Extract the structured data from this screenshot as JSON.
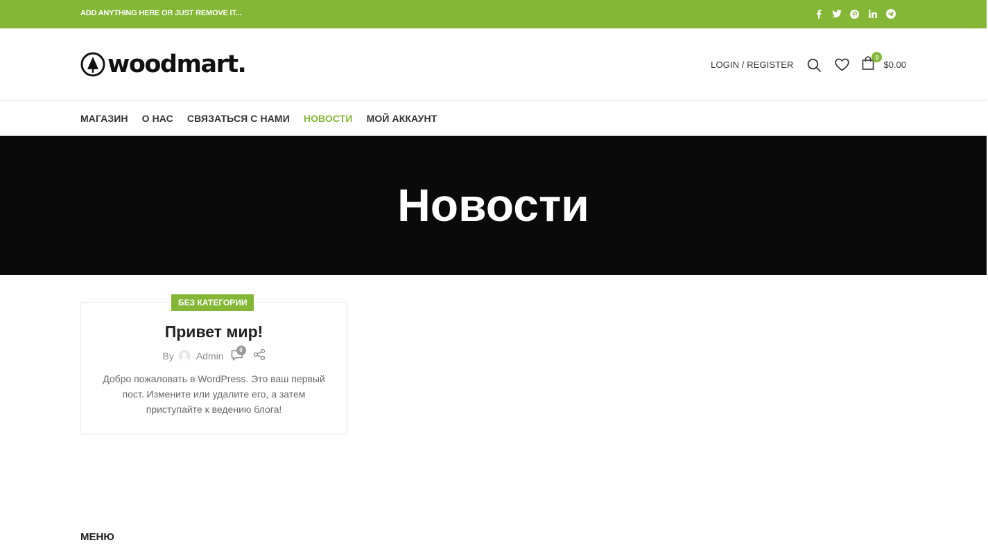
{
  "topbar": {
    "text": "ADD ANYTHING HERE OR JUST REMOVE IT...",
    "social": [
      "facebook-icon",
      "twitter-icon",
      "pinterest-icon",
      "linkedin-icon",
      "telegram-icon"
    ]
  },
  "header": {
    "logo_text": "woodmart.",
    "login_label": "LOGIN / REGISTER",
    "cart_count": "0",
    "cart_amount": "$0.00"
  },
  "nav": {
    "items": [
      {
        "label": "МАГАЗИН"
      },
      {
        "label": "О НАС"
      },
      {
        "label": "СВЯЗАТЬСЯ С НАМИ"
      },
      {
        "label": "НОВОСТИ",
        "active": true
      },
      {
        "label": "МОЙ АККАУНТ"
      }
    ]
  },
  "hero": {
    "title": "Новости"
  },
  "post": {
    "category": "БЕЗ КАТЕГОРИИ",
    "title": "Привет мир!",
    "by": "By",
    "author": "Admin",
    "comment_count": "0",
    "excerpt": "Добро пожаловать в WordPress. Это ваш первый пост. Измените или удалите его, а затем приступайте к ведению блога!"
  },
  "footer": {
    "menu_title": "МЕНЮ"
  },
  "colors": {
    "accent": "#83b735",
    "hero_bg": "#0a0a0a"
  }
}
